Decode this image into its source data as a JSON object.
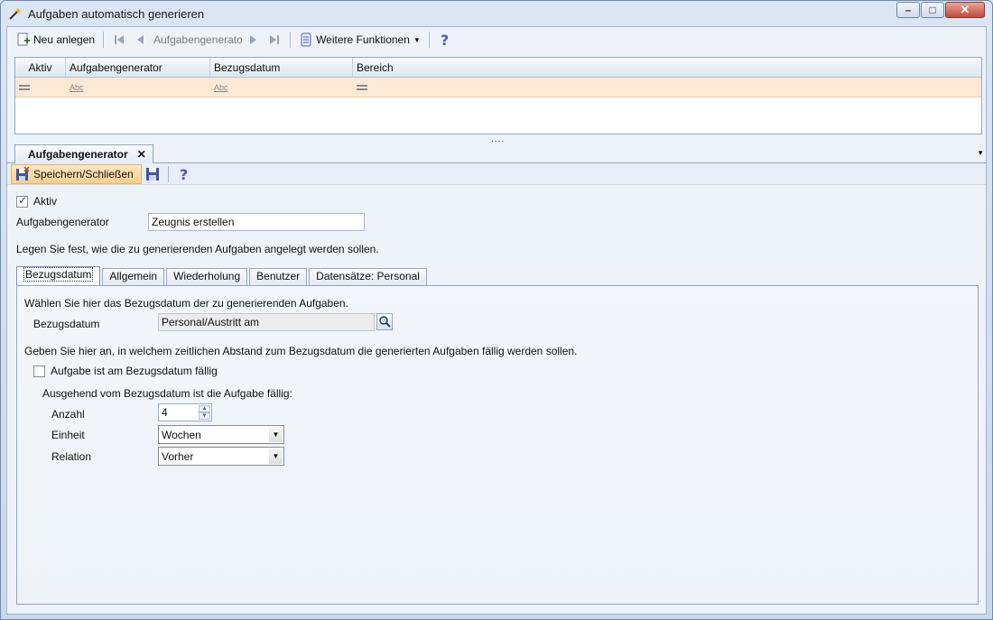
{
  "window": {
    "title": "Aufgaben automatisch generieren"
  },
  "toolbar": {
    "new_label": "Neu anlegen",
    "nav_combo": "Aufgabengenerator",
    "more_label": "Weitere Funktionen"
  },
  "grid": {
    "columns": [
      "Aktiv",
      "Aufgabengenerator",
      "Bezugsdatum",
      "Bereich"
    ],
    "filter_abc": "Abc"
  },
  "splitter": "....",
  "doc_tab": {
    "label": "Aufgabengenerator",
    "close": "✕"
  },
  "toolbar2": {
    "save_close_label": "Speichern/Schließen"
  },
  "form": {
    "active_label": "Aktiv",
    "active_checked": true,
    "generator_label": "Aufgabengenerator",
    "generator_value": "Zeugnis erstellen",
    "intro": "Legen Sie fest, wie die zu generierenden Aufgaben angelegt werden sollen."
  },
  "tabs": [
    "Bezugsdatum",
    "Allgemein",
    "Wiederholung",
    "Benutzer",
    "Datensätze: Personal"
  ],
  "panel": {
    "hint1": "Wählen Sie hier das Bezugsdatum der zu generierenden Aufgaben.",
    "ref_date_label": "Bezugsdatum",
    "ref_date_value": "Personal/Austritt am",
    "hint2": "Geben Sie hier an, in welchem zeitlichen Abstand zum Bezugsdatum die generierten Aufgaben fällig werden sollen.",
    "due_on_date_label": "Aufgabe ist am Bezugsdatum fällig",
    "due_on_date_checked": false,
    "from_date_label": "Ausgehend vom Bezugsdatum ist die Aufgabe fällig:",
    "count_label": "Anzahl",
    "count_value": "4",
    "unit_label": "Einheit",
    "unit_value": "Wochen",
    "relation_label": "Relation",
    "relation_value": "Vorher"
  }
}
